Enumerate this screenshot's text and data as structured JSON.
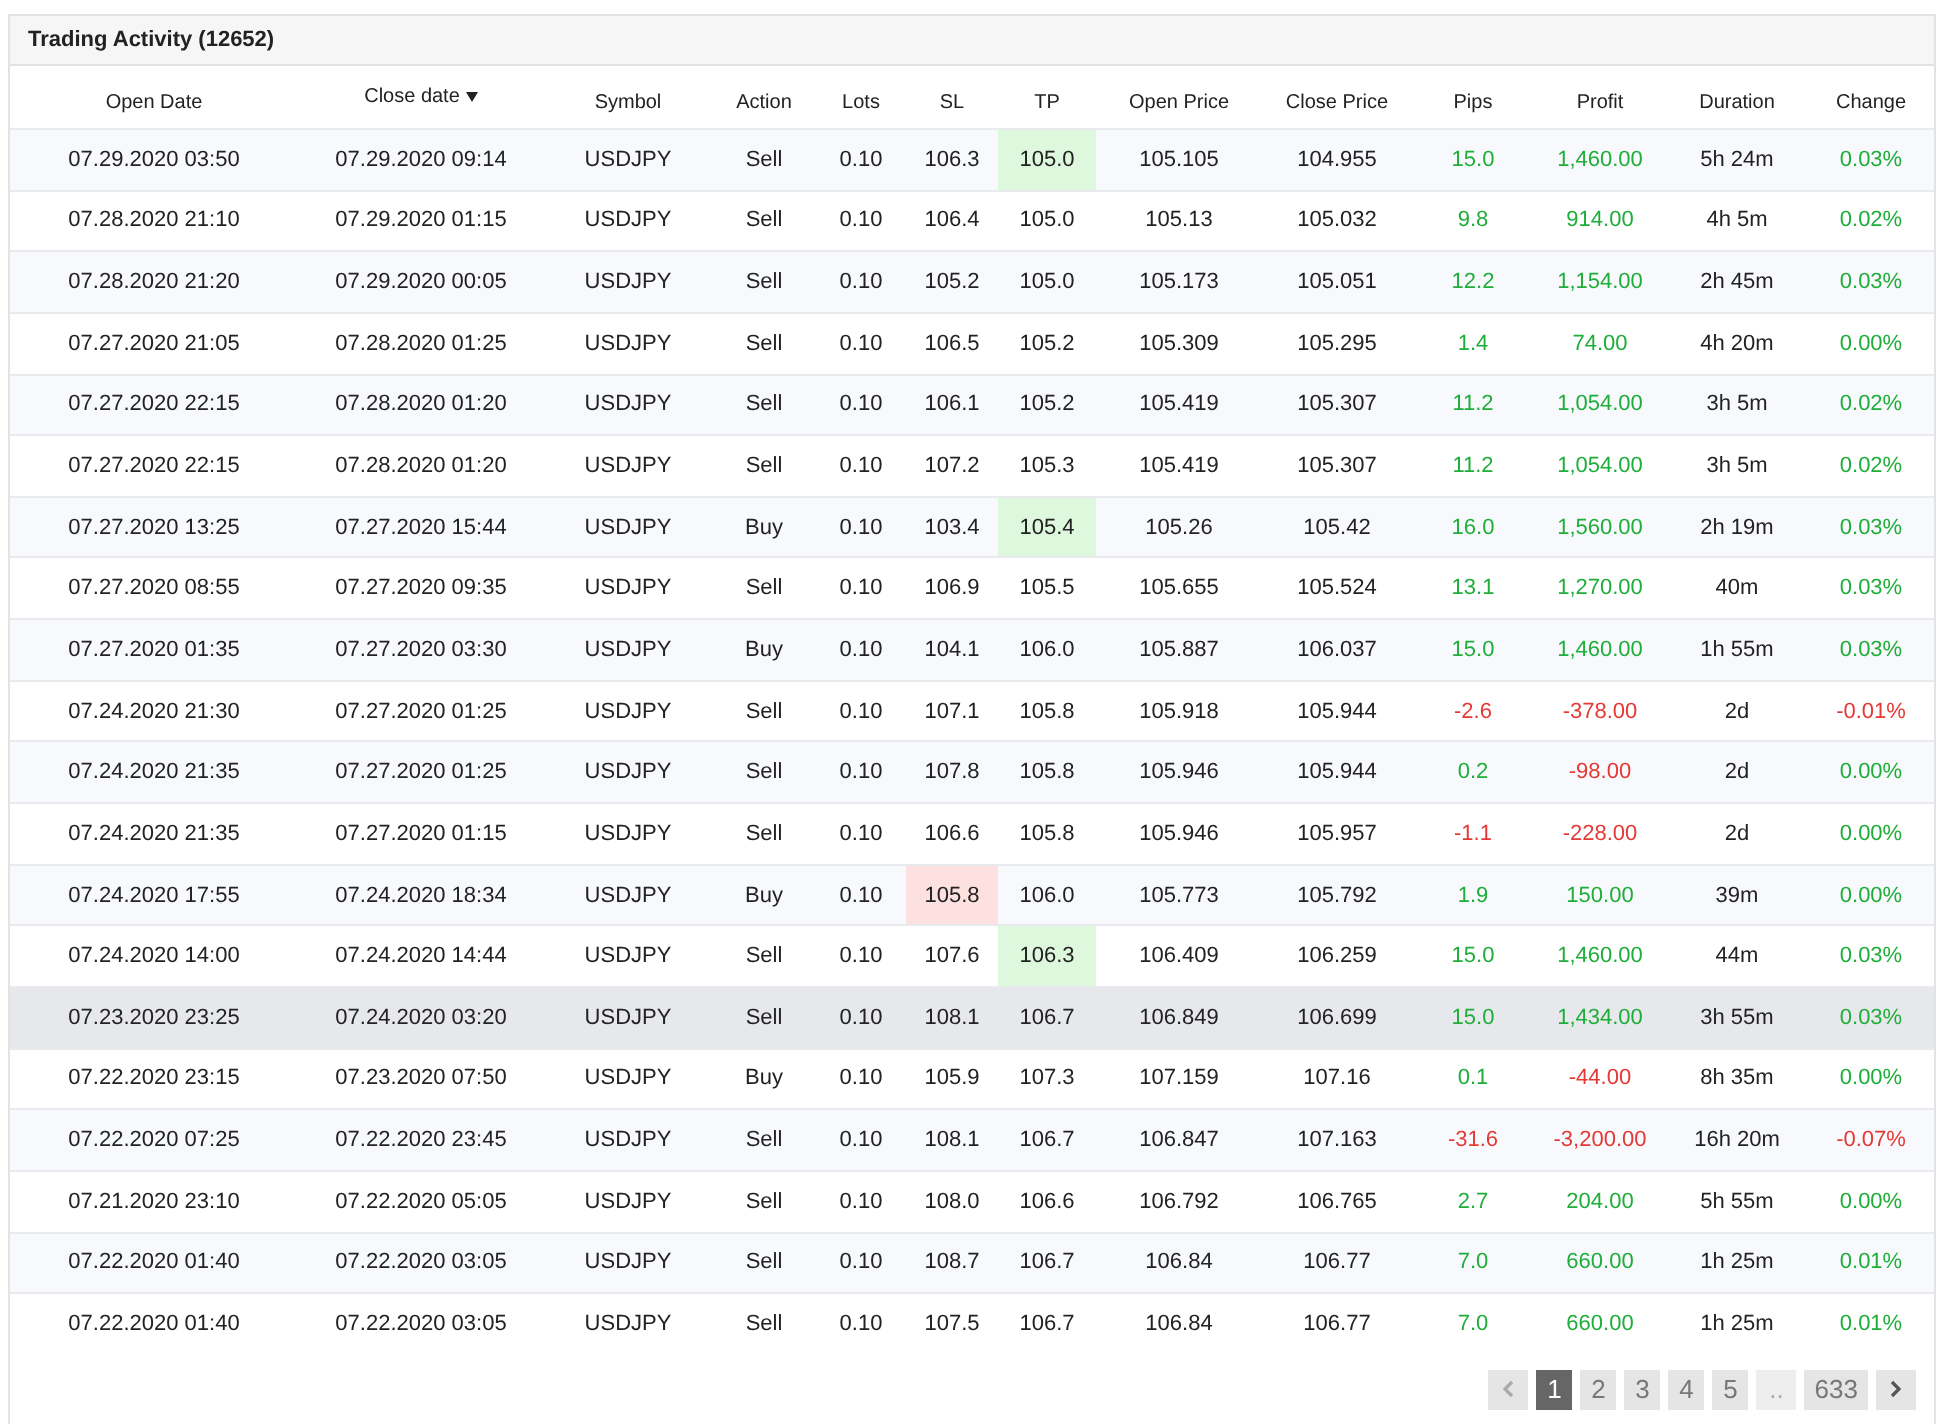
{
  "panel": {
    "title": "Trading Activity (12652)"
  },
  "table": {
    "columns": [
      {
        "label": "Open Date",
        "sorted": false
      },
      {
        "label": "Close date",
        "sorted": true
      },
      {
        "label": "Symbol",
        "sorted": false
      },
      {
        "label": "Action",
        "sorted": false
      },
      {
        "label": "Lots",
        "sorted": false
      },
      {
        "label": "SL",
        "sorted": false
      },
      {
        "label": "TP",
        "sorted": false
      },
      {
        "label": "Open Price",
        "sorted": false
      },
      {
        "label": "Close Price",
        "sorted": false
      },
      {
        "label": "Pips",
        "sorted": false
      },
      {
        "label": "Profit",
        "sorted": false
      },
      {
        "label": "Duration",
        "sorted": false
      },
      {
        "label": "Change",
        "sorted": false
      }
    ],
    "rows": [
      {
        "open_date": "07.29.2020 03:50",
        "close_date": "07.29.2020 09:14",
        "symbol": "USDJPY",
        "action": "Sell",
        "lots": "0.10",
        "sl": "106.3",
        "tp": "105.0",
        "open_price": "105.105",
        "close_price": "104.955",
        "pips": "15.0",
        "profit": "1,460.00",
        "duration": "5h 24m",
        "change": "0.03%",
        "sl_hit": false,
        "tp_hit": true,
        "pips_loss": false,
        "profit_loss": false,
        "change_loss": false,
        "hovered": false
      },
      {
        "open_date": "07.28.2020 21:10",
        "close_date": "07.29.2020 01:15",
        "symbol": "USDJPY",
        "action": "Sell",
        "lots": "0.10",
        "sl": "106.4",
        "tp": "105.0",
        "open_price": "105.13",
        "close_price": "105.032",
        "pips": "9.8",
        "profit": "914.00",
        "duration": "4h 5m",
        "change": "0.02%",
        "sl_hit": false,
        "tp_hit": false,
        "pips_loss": false,
        "profit_loss": false,
        "change_loss": false,
        "hovered": false
      },
      {
        "open_date": "07.28.2020 21:20",
        "close_date": "07.29.2020 00:05",
        "symbol": "USDJPY",
        "action": "Sell",
        "lots": "0.10",
        "sl": "105.2",
        "tp": "105.0",
        "open_price": "105.173",
        "close_price": "105.051",
        "pips": "12.2",
        "profit": "1,154.00",
        "duration": "2h 45m",
        "change": "0.03%",
        "sl_hit": false,
        "tp_hit": false,
        "pips_loss": false,
        "profit_loss": false,
        "change_loss": false,
        "hovered": false
      },
      {
        "open_date": "07.27.2020 21:05",
        "close_date": "07.28.2020 01:25",
        "symbol": "USDJPY",
        "action": "Sell",
        "lots": "0.10",
        "sl": "106.5",
        "tp": "105.2",
        "open_price": "105.309",
        "close_price": "105.295",
        "pips": "1.4",
        "profit": "74.00",
        "duration": "4h 20m",
        "change": "0.00%",
        "sl_hit": false,
        "tp_hit": false,
        "pips_loss": false,
        "profit_loss": false,
        "change_loss": false,
        "hovered": false
      },
      {
        "open_date": "07.27.2020 22:15",
        "close_date": "07.28.2020 01:20",
        "symbol": "USDJPY",
        "action": "Sell",
        "lots": "0.10",
        "sl": "106.1",
        "tp": "105.2",
        "open_price": "105.419",
        "close_price": "105.307",
        "pips": "11.2",
        "profit": "1,054.00",
        "duration": "3h 5m",
        "change": "0.02%",
        "sl_hit": false,
        "tp_hit": false,
        "pips_loss": false,
        "profit_loss": false,
        "change_loss": false,
        "hovered": false
      },
      {
        "open_date": "07.27.2020 22:15",
        "close_date": "07.28.2020 01:20",
        "symbol": "USDJPY",
        "action": "Sell",
        "lots": "0.10",
        "sl": "107.2",
        "tp": "105.3",
        "open_price": "105.419",
        "close_price": "105.307",
        "pips": "11.2",
        "profit": "1,054.00",
        "duration": "3h 5m",
        "change": "0.02%",
        "sl_hit": false,
        "tp_hit": false,
        "pips_loss": false,
        "profit_loss": false,
        "change_loss": false,
        "hovered": false
      },
      {
        "open_date": "07.27.2020 13:25",
        "close_date": "07.27.2020 15:44",
        "symbol": "USDJPY",
        "action": "Buy",
        "lots": "0.10",
        "sl": "103.4",
        "tp": "105.4",
        "open_price": "105.26",
        "close_price": "105.42",
        "pips": "16.0",
        "profit": "1,560.00",
        "duration": "2h 19m",
        "change": "0.03%",
        "sl_hit": false,
        "tp_hit": true,
        "pips_loss": false,
        "profit_loss": false,
        "change_loss": false,
        "hovered": false
      },
      {
        "open_date": "07.27.2020 08:55",
        "close_date": "07.27.2020 09:35",
        "symbol": "USDJPY",
        "action": "Sell",
        "lots": "0.10",
        "sl": "106.9",
        "tp": "105.5",
        "open_price": "105.655",
        "close_price": "105.524",
        "pips": "13.1",
        "profit": "1,270.00",
        "duration": "40m",
        "change": "0.03%",
        "sl_hit": false,
        "tp_hit": false,
        "pips_loss": false,
        "profit_loss": false,
        "change_loss": false,
        "hovered": false
      },
      {
        "open_date": "07.27.2020 01:35",
        "close_date": "07.27.2020 03:30",
        "symbol": "USDJPY",
        "action": "Buy",
        "lots": "0.10",
        "sl": "104.1",
        "tp": "106.0",
        "open_price": "105.887",
        "close_price": "106.037",
        "pips": "15.0",
        "profit": "1,460.00",
        "duration": "1h 55m",
        "change": "0.03%",
        "sl_hit": false,
        "tp_hit": false,
        "pips_loss": false,
        "profit_loss": false,
        "change_loss": false,
        "hovered": false
      },
      {
        "open_date": "07.24.2020 21:30",
        "close_date": "07.27.2020 01:25",
        "symbol": "USDJPY",
        "action": "Sell",
        "lots": "0.10",
        "sl": "107.1",
        "tp": "105.8",
        "open_price": "105.918",
        "close_price": "105.944",
        "pips": "-2.6",
        "profit": "-378.00",
        "duration": "2d",
        "change": "-0.01%",
        "sl_hit": false,
        "tp_hit": false,
        "pips_loss": true,
        "profit_loss": true,
        "change_loss": true,
        "hovered": false
      },
      {
        "open_date": "07.24.2020 21:35",
        "close_date": "07.27.2020 01:25",
        "symbol": "USDJPY",
        "action": "Sell",
        "lots": "0.10",
        "sl": "107.8",
        "tp": "105.8",
        "open_price": "105.946",
        "close_price": "105.944",
        "pips": "0.2",
        "profit": "-98.00",
        "duration": "2d",
        "change": "0.00%",
        "sl_hit": false,
        "tp_hit": false,
        "pips_loss": false,
        "profit_loss": true,
        "change_loss": false,
        "hovered": false
      },
      {
        "open_date": "07.24.2020 21:35",
        "close_date": "07.27.2020 01:15",
        "symbol": "USDJPY",
        "action": "Sell",
        "lots": "0.10",
        "sl": "106.6",
        "tp": "105.8",
        "open_price": "105.946",
        "close_price": "105.957",
        "pips": "-1.1",
        "profit": "-228.00",
        "duration": "2d",
        "change": "0.00%",
        "sl_hit": false,
        "tp_hit": false,
        "pips_loss": true,
        "profit_loss": true,
        "change_loss": false,
        "hovered": false
      },
      {
        "open_date": "07.24.2020 17:55",
        "close_date": "07.24.2020 18:34",
        "symbol": "USDJPY",
        "action": "Buy",
        "lots": "0.10",
        "sl": "105.8",
        "tp": "106.0",
        "open_price": "105.773",
        "close_price": "105.792",
        "pips": "1.9",
        "profit": "150.00",
        "duration": "39m",
        "change": "0.00%",
        "sl_hit": true,
        "tp_hit": false,
        "pips_loss": false,
        "profit_loss": false,
        "change_loss": false,
        "hovered": false
      },
      {
        "open_date": "07.24.2020 14:00",
        "close_date": "07.24.2020 14:44",
        "symbol": "USDJPY",
        "action": "Sell",
        "lots": "0.10",
        "sl": "107.6",
        "tp": "106.3",
        "open_price": "106.409",
        "close_price": "106.259",
        "pips": "15.0",
        "profit": "1,460.00",
        "duration": "44m",
        "change": "0.03%",
        "sl_hit": false,
        "tp_hit": true,
        "pips_loss": false,
        "profit_loss": false,
        "change_loss": false,
        "hovered": false
      },
      {
        "open_date": "07.23.2020 23:25",
        "close_date": "07.24.2020 03:20",
        "symbol": "USDJPY",
        "action": "Sell",
        "lots": "0.10",
        "sl": "108.1",
        "tp": "106.7",
        "open_price": "106.849",
        "close_price": "106.699",
        "pips": "15.0",
        "profit": "1,434.00",
        "duration": "3h 55m",
        "change": "0.03%",
        "sl_hit": false,
        "tp_hit": false,
        "pips_loss": false,
        "profit_loss": false,
        "change_loss": false,
        "hovered": true
      },
      {
        "open_date": "07.22.2020 23:15",
        "close_date": "07.23.2020 07:50",
        "symbol": "USDJPY",
        "action": "Buy",
        "lots": "0.10",
        "sl": "105.9",
        "tp": "107.3",
        "open_price": "107.159",
        "close_price": "107.16",
        "pips": "0.1",
        "profit": "-44.00",
        "duration": "8h 35m",
        "change": "0.00%",
        "sl_hit": false,
        "tp_hit": false,
        "pips_loss": false,
        "profit_loss": true,
        "change_loss": false,
        "hovered": false
      },
      {
        "open_date": "07.22.2020 07:25",
        "close_date": "07.22.2020 23:45",
        "symbol": "USDJPY",
        "action": "Sell",
        "lots": "0.10",
        "sl": "108.1",
        "tp": "106.7",
        "open_price": "106.847",
        "close_price": "107.163",
        "pips": "-31.6",
        "profit": "-3,200.00",
        "duration": "16h 20m",
        "change": "-0.07%",
        "sl_hit": false,
        "tp_hit": false,
        "pips_loss": true,
        "profit_loss": true,
        "change_loss": true,
        "hovered": false
      },
      {
        "open_date": "07.21.2020 23:10",
        "close_date": "07.22.2020 05:05",
        "symbol": "USDJPY",
        "action": "Sell",
        "lots": "0.10",
        "sl": "108.0",
        "tp": "106.6",
        "open_price": "106.792",
        "close_price": "106.765",
        "pips": "2.7",
        "profit": "204.00",
        "duration": "5h 55m",
        "change": "0.00%",
        "sl_hit": false,
        "tp_hit": false,
        "pips_loss": false,
        "profit_loss": false,
        "change_loss": false,
        "hovered": false
      },
      {
        "open_date": "07.22.2020 01:40",
        "close_date": "07.22.2020 03:05",
        "symbol": "USDJPY",
        "action": "Sell",
        "lots": "0.10",
        "sl": "108.7",
        "tp": "106.7",
        "open_price": "106.84",
        "close_price": "106.77",
        "pips": "7.0",
        "profit": "660.00",
        "duration": "1h 25m",
        "change": "0.01%",
        "sl_hit": false,
        "tp_hit": false,
        "pips_loss": false,
        "profit_loss": false,
        "change_loss": false,
        "hovered": false
      },
      {
        "open_date": "07.22.2020 01:40",
        "close_date": "07.22.2020 03:05",
        "symbol": "USDJPY",
        "action": "Sell",
        "lots": "0.10",
        "sl": "107.5",
        "tp": "106.7",
        "open_price": "106.84",
        "close_price": "106.77",
        "pips": "7.0",
        "profit": "660.00",
        "duration": "1h 25m",
        "change": "0.01%",
        "sl_hit": false,
        "tp_hit": false,
        "pips_loss": false,
        "profit_loss": false,
        "change_loss": false,
        "hovered": false
      }
    ]
  },
  "pagination": {
    "pages": [
      {
        "label": "1",
        "selected": true
      },
      {
        "label": "2",
        "selected": false
      },
      {
        "label": "3",
        "selected": false
      },
      {
        "label": "4",
        "selected": false
      },
      {
        "label": "5",
        "selected": false
      }
    ],
    "gap": "..",
    "last": "633"
  }
}
